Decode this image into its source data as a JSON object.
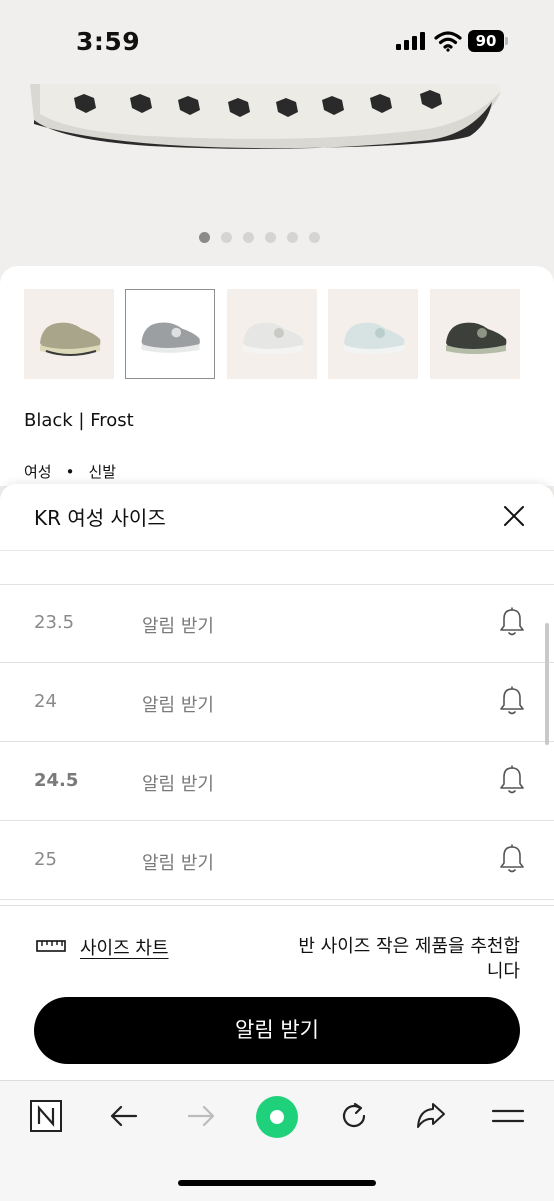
{
  "status_bar": {
    "time": "3:59",
    "battery": "90"
  },
  "carousel": {
    "total": 6,
    "active": 0
  },
  "thumbnails": [
    {
      "name": "thumbnail-colorway-1",
      "selected": false
    },
    {
      "name": "thumbnail-colorway-2",
      "selected": true
    },
    {
      "name": "thumbnail-colorway-3",
      "selected": false
    },
    {
      "name": "thumbnail-colorway-4",
      "selected": false
    },
    {
      "name": "thumbnail-colorway-5",
      "selected": false
    }
  ],
  "product": {
    "colorway": "Black | Frost",
    "gender": "여성",
    "separator": "•",
    "type": "신발"
  },
  "size_panel": {
    "title": "KR 여성 사이즈",
    "rows": [
      {
        "size": "23.5",
        "action": "알림 받기"
      },
      {
        "size": "24",
        "action": "알림 받기"
      },
      {
        "size": "24.5",
        "action": "알림 받기"
      },
      {
        "size": "25",
        "action": "알림 받기"
      }
    ],
    "size_chart_label": "사이즈 차트",
    "recommendation": "반 사이즈 작은 제품을 추천합니다",
    "cta_label": "알림 받기"
  },
  "browser_toolbar": {
    "icons": [
      "notion-icon",
      "back-arrow-icon",
      "forward-arrow-icon",
      "record-icon",
      "reload-icon",
      "share-icon",
      "menu-icon"
    ],
    "accent": "#1fd17a"
  }
}
